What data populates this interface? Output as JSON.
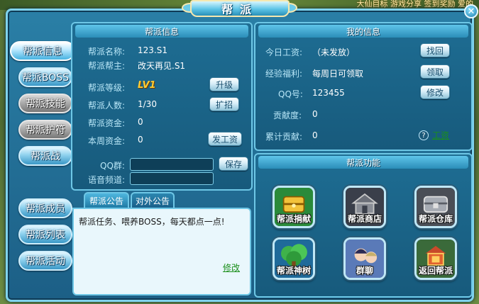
{
  "top_links": "大仙目标 游戏分享 签到奖励 爱的",
  "title": "帮派",
  "close_symbol": "✕",
  "side_tabs": [
    {
      "label": "帮派信息",
      "active": true
    },
    {
      "label": "帮派BOSS"
    },
    {
      "label": "帮派技能"
    },
    {
      "label": "帮派护符"
    },
    {
      "label": "帮派战"
    },
    {
      "label": "帮派成员"
    },
    {
      "label": "帮派列表"
    },
    {
      "label": "帮派活动"
    }
  ],
  "guild_info": {
    "header": "帮派信息",
    "name_label": "帮派名称:",
    "name_value": "123.S1",
    "leader_label": "帮派帮主:",
    "leader_value": "改天再见.S1",
    "level_label": "帮派等级:",
    "level_value": "LV1",
    "level_button": "升级",
    "members_label": "帮派人数:",
    "members_value": "1/30",
    "members_button": "扩招",
    "funds_label": "帮派资金:",
    "funds_value": "0",
    "weekly_label": "本周资金:",
    "weekly_value": "0",
    "weekly_button": "发工资",
    "qq_group_label": "QQ群:",
    "qq_group_value": "",
    "voice_label": "语音频道:",
    "voice_value": "",
    "save_button": "保存"
  },
  "notice": {
    "tab_internal": "帮派公告",
    "tab_external": "对外公告",
    "text": "帮派任务、喂养BOSS，每天都点一点!",
    "edit_link": "修改"
  },
  "my_info": {
    "header": "我的信息",
    "wage_label": "今日工资:",
    "wage_value": "（未发放）",
    "wage_button": "找回",
    "exp_label": "经验福利:",
    "exp_value": "每周日可领取",
    "exp_button": "领取",
    "qq_label": "QQ号:",
    "qq_value": "123455",
    "qq_button": "修改",
    "contrib_label": "贡献度:",
    "contrib_value": "0",
    "total_label": "累计贡献:",
    "total_value": "0",
    "help_symbol": "?",
    "wage_link": "工资"
  },
  "functions": {
    "header": "帮派功能",
    "items": [
      {
        "label": "帮派捐献",
        "icon": "chest-icon"
      },
      {
        "label": "帮派商店",
        "icon": "shop-icon"
      },
      {
        "label": "帮派仓库",
        "icon": "warehouse-icon"
      },
      {
        "label": "帮派神树",
        "icon": "tree-icon"
      },
      {
        "label": "群聊",
        "icon": "chat-icon"
      },
      {
        "label": "返回帮派",
        "icon": "return-icon"
      }
    ]
  },
  "colors": {
    "frame": "#1c5f86",
    "accent": "#6ec7e6",
    "level": "#ffcc33",
    "link": "#1b8f1b"
  }
}
